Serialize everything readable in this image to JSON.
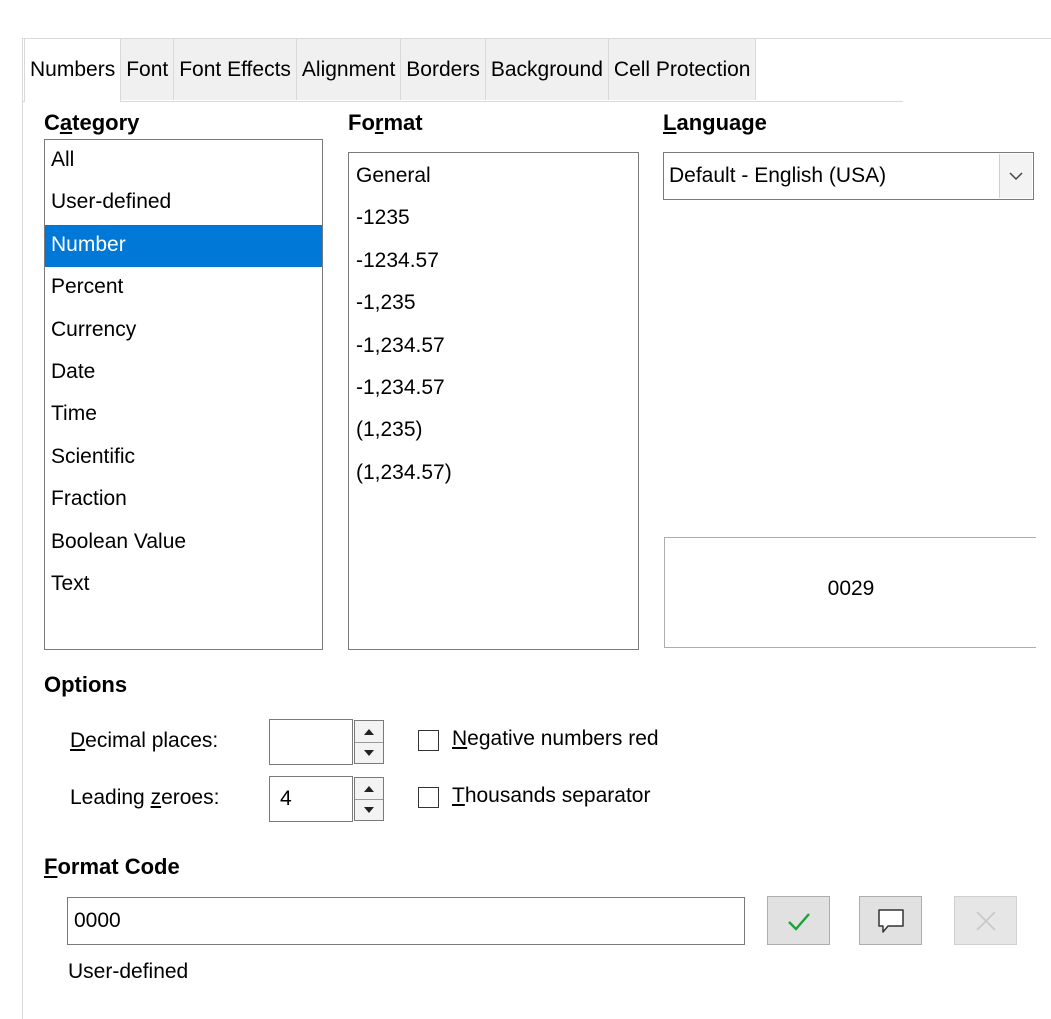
{
  "tabs": [
    {
      "label": "Numbers",
      "active": true
    },
    {
      "label": "Font",
      "active": false
    },
    {
      "label": "Font Effects",
      "active": false
    },
    {
      "label": "Alignment",
      "active": false
    },
    {
      "label": "Borders",
      "active": false
    },
    {
      "label": "Background",
      "active": false
    },
    {
      "label": "Cell Protection",
      "active": false
    }
  ],
  "category": {
    "heading_pre": "C",
    "heading_mnemonic": "a",
    "heading_post": "tegory",
    "items": [
      "All",
      "User-defined",
      "Number",
      "Percent",
      "Currency",
      "Date",
      "Time",
      "Scientific",
      "Fraction",
      "Boolean Value",
      "Text"
    ],
    "selected": "Number"
  },
  "format": {
    "heading_pre": "Fo",
    "heading_mnemonic": "r",
    "heading_post": "mat",
    "items": [
      "General",
      "-1235",
      "-1234.57",
      "-1,235",
      "-1,234.57",
      "-1,234.57",
      "(1,235)",
      "(1,234.57)"
    ],
    "negative_red_item": "-1,234.57"
  },
  "language": {
    "heading_mnemonic": "L",
    "heading_post": "anguage",
    "value": "Default - English (USA)"
  },
  "preview": {
    "value": "0029"
  },
  "options": {
    "heading": "Options",
    "decimal_label_mnemonic": "D",
    "decimal_label_post": "ecimal places:",
    "decimal_value": "",
    "leading_label_pre": "Leading ",
    "leading_label_mnemonic": "z",
    "leading_label_post": "eroes:",
    "leading_value": "4",
    "negative_red_mnemonic": "N",
    "negative_red_post": "egative numbers red",
    "negative_red_checked": false,
    "thousands_mnemonic": "T",
    "thousands_post": "housands separator",
    "thousands_checked": false
  },
  "format_code": {
    "heading_mnemonic": "F",
    "heading_post": "ormat Code",
    "value": "0000",
    "description": "User-defined"
  },
  "colors": {
    "selection": "#0078d7",
    "accept_check": "#1aa33a",
    "disabled": "#c8c8c8"
  },
  "icons": [
    "chevron-down-icon",
    "spin-up-icon",
    "spin-down-icon",
    "checkmark-icon",
    "comment-icon",
    "delete-icon"
  ]
}
